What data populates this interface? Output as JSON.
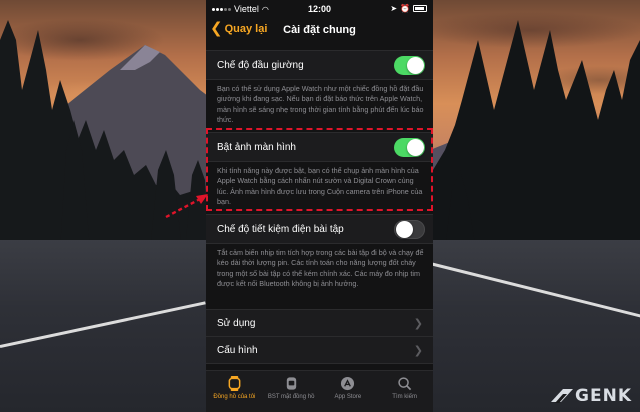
{
  "status_bar": {
    "carrier": "Viettel",
    "time": "12:00"
  },
  "nav": {
    "back_label": "Quay lại",
    "title": "Cài đặt chung"
  },
  "settings": [
    {
      "label": "Chế độ đầu giường",
      "toggle": "on",
      "description": "Bạn có thể sử dụng Apple Watch như một chiếc đồng hồ đặt đầu giường khi đang sạc. Nếu bạn di đặt báo thức trên Apple Watch, màn hình sẽ sáng nhẹ trong thời gian tính bằng phút đến lúc báo thức."
    },
    {
      "label": "Bật ảnh màn hình",
      "toggle": "on",
      "description": "Khi tính năng này được bật, bạn có thể chụp ảnh màn hình của Apple Watch bằng cách nhấn nút sườn và Digital Crown cùng lúc. Ảnh màn hình được lưu trong Cuộn camera trên iPhone của bạn."
    },
    {
      "label": "Chế độ tiết kiệm điện bài tập",
      "toggle": "off",
      "description": "Tắt cảm biến nhịp tim tích hợp trong các bài tập đi bộ và chạy để kéo dài thời lượng pin. Các tính toán cho năng lượng đốt cháy trong một số bài tập có thể kém chính xác. Các máy đo nhịp tim được kết nối Bluetooth không bị ảnh hưởng."
    }
  ],
  "links": [
    {
      "label": "Sử dụng"
    },
    {
      "label": "Cấu hình"
    }
  ],
  "tabs": [
    {
      "label": "Đồng hồ của tôi",
      "icon": "watch-icon",
      "active": true
    },
    {
      "label": "BST mặt đồng hồ",
      "icon": "watch-face-gallery-icon",
      "active": false
    },
    {
      "label": "App Store",
      "icon": "app-store-icon",
      "active": false
    },
    {
      "label": "Tìm kiếm",
      "icon": "search-icon",
      "active": false
    }
  ],
  "colors": {
    "accent": "#f7a723",
    "toggle_on": "#4cd964",
    "highlight": "#e0142a"
  },
  "watermark": {
    "text": "GENK"
  }
}
